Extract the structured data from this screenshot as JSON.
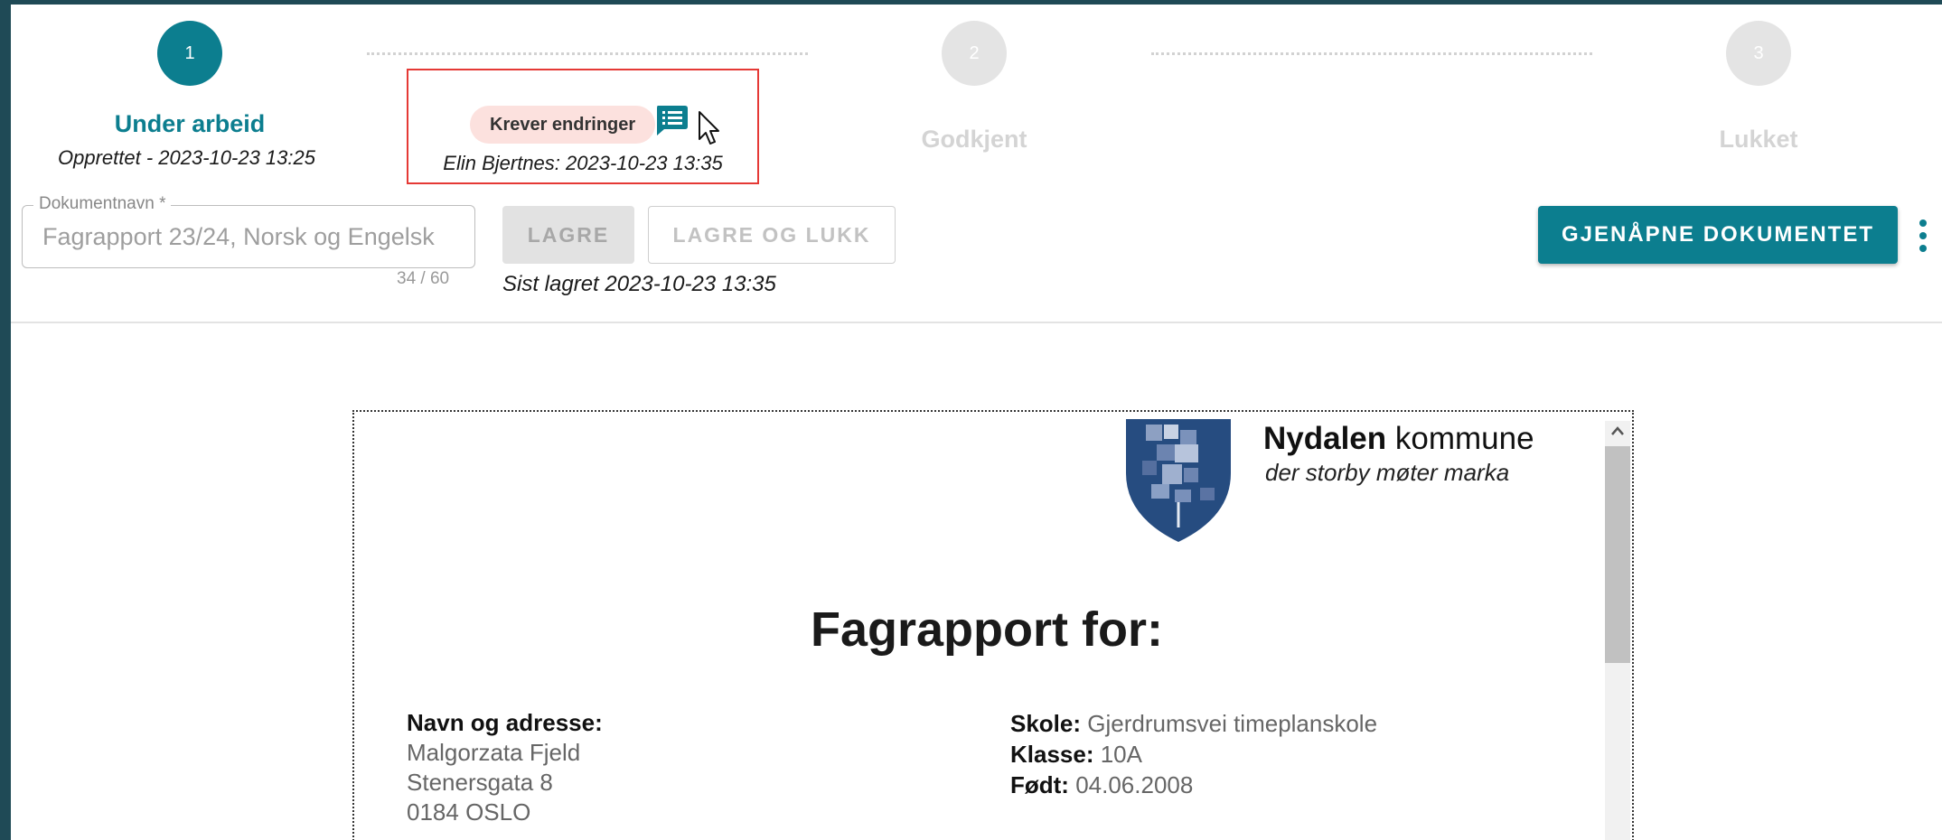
{
  "stepper": {
    "steps": [
      {
        "number": "1",
        "title": "Under arbeid",
        "subtitle": "Opprettet - 2023-10-23 13:25"
      },
      {
        "number": "2",
        "title": "Godkjent"
      },
      {
        "number": "3",
        "title": "Lukket"
      }
    ],
    "status_chip": "Krever endringer",
    "status_meta": "Elin Bjertnes: 2023-10-23 13:35"
  },
  "toolbar": {
    "field_label": "Dokumentnavn *",
    "field_value": "Fagrapport 23/24, Norsk og Engelsk",
    "counter": "34 / 60",
    "save_label": "LAGRE",
    "save_close_label": "LAGRE OG LUKK",
    "last_saved": "Sist lagret 2023-10-23 13:35",
    "reopen_label": "GJENÅPNE DOKUMENTET"
  },
  "document": {
    "brand_bold": "Nydalen",
    "brand_rest": " kommune",
    "tagline": "der storby møter marka",
    "title": "Fagrapport for:",
    "left": {
      "label": "Navn og adresse:",
      "lines": [
        "Malgorzata Fjeld",
        "Stenersgata 8",
        "0184 OSLO"
      ]
    },
    "right": [
      {
        "label": "Skole:",
        "value": " Gjerdrumsvei timeplanskole"
      },
      {
        "label": "Klasse:",
        "value": " 10A"
      },
      {
        "label": "Født:",
        "value": " 04.06.2008"
      }
    ]
  },
  "colors": {
    "accent": "#0c7e8f",
    "chip_bg": "#fce1de",
    "highlight_border": "#e53935"
  },
  "icons": [
    "comment-list-icon",
    "mouse-cursor-icon",
    "kebab-menu-icon",
    "scroll-up-arrow-icon",
    "municipality-crest-logo"
  ]
}
